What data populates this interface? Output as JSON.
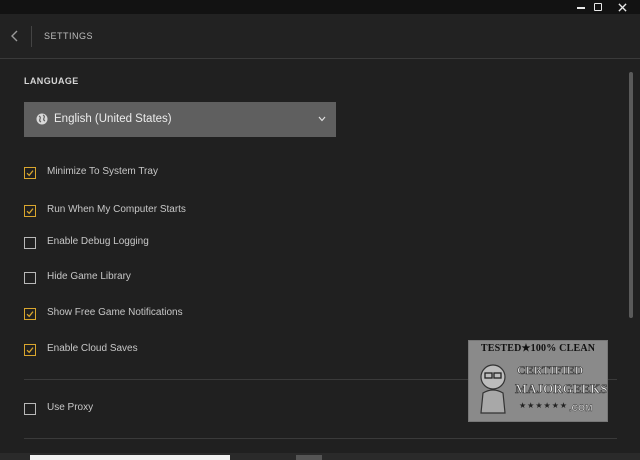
{
  "header": {
    "title": "SETTINGS"
  },
  "language": {
    "section_label": "LANGUAGE",
    "selected": "English (United States)",
    "icon": "globe-icon"
  },
  "options": [
    {
      "label": "Minimize To System Tray",
      "checked": true
    },
    {
      "label": "Run When My Computer Starts",
      "checked": true
    },
    {
      "label": "Enable Debug Logging",
      "checked": false
    },
    {
      "label": "Hide Game Library",
      "checked": false
    },
    {
      "label": "Show Free Game Notifications",
      "checked": true
    },
    {
      "label": "Enable Cloud Saves",
      "checked": true
    }
  ],
  "proxy": {
    "label": "Use Proxy",
    "checked": false
  },
  "watermark": {
    "top": "TESTED★100% CLEAN",
    "certified": "CERTIFIED",
    "brand": "MAJORGEEKS",
    "stars": "★★★★★★",
    "domain": ".COM"
  },
  "colors": {
    "accent": "#d9a62e",
    "background": "#202020",
    "select_bg": "#5f5f5f"
  }
}
